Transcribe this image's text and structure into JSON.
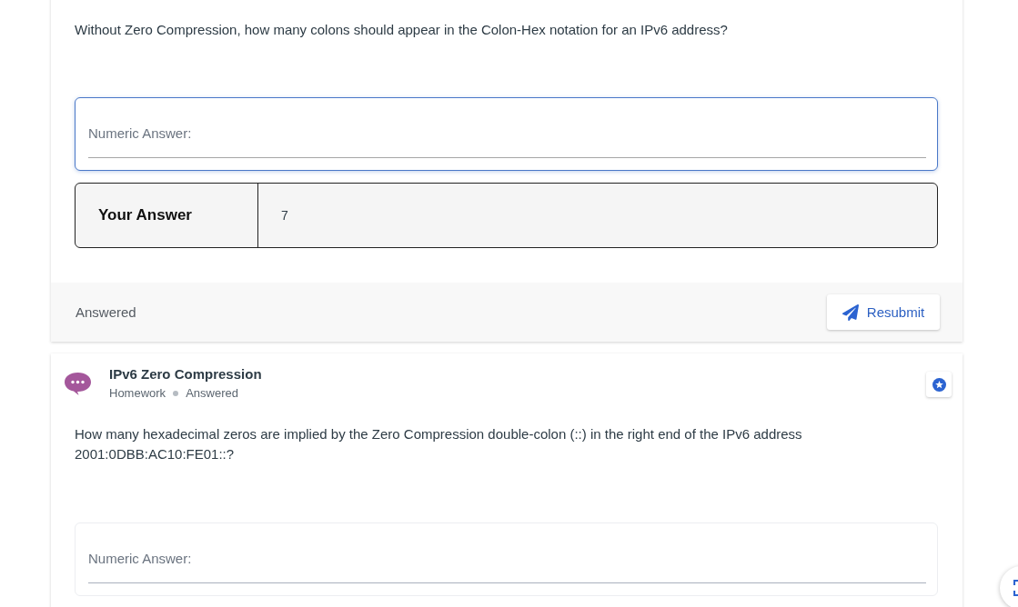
{
  "cards": [
    {
      "prompt": "Without Zero Compression, how many colons should appear in the Colon-Hex notation for an IPv6 address?",
      "answer_field": {
        "placeholder": "Numeric Answer:",
        "focused": true
      },
      "your_answer": {
        "label": "Your Answer",
        "value": "7"
      },
      "footer": {
        "status": "Answered",
        "button": "Resubmit"
      }
    },
    {
      "title": "IPv6 Zero Compression",
      "meta": [
        "Homework",
        "Answered"
      ],
      "prompt": "How many hexadecimal zeros are implied by the Zero Compression double-colon (::) in the right end of the IPv6 address 2001:0DBB:AC10:FE01::?",
      "answer_field": {
        "placeholder": "Numeric Answer:",
        "focused": false
      }
    }
  ]
}
